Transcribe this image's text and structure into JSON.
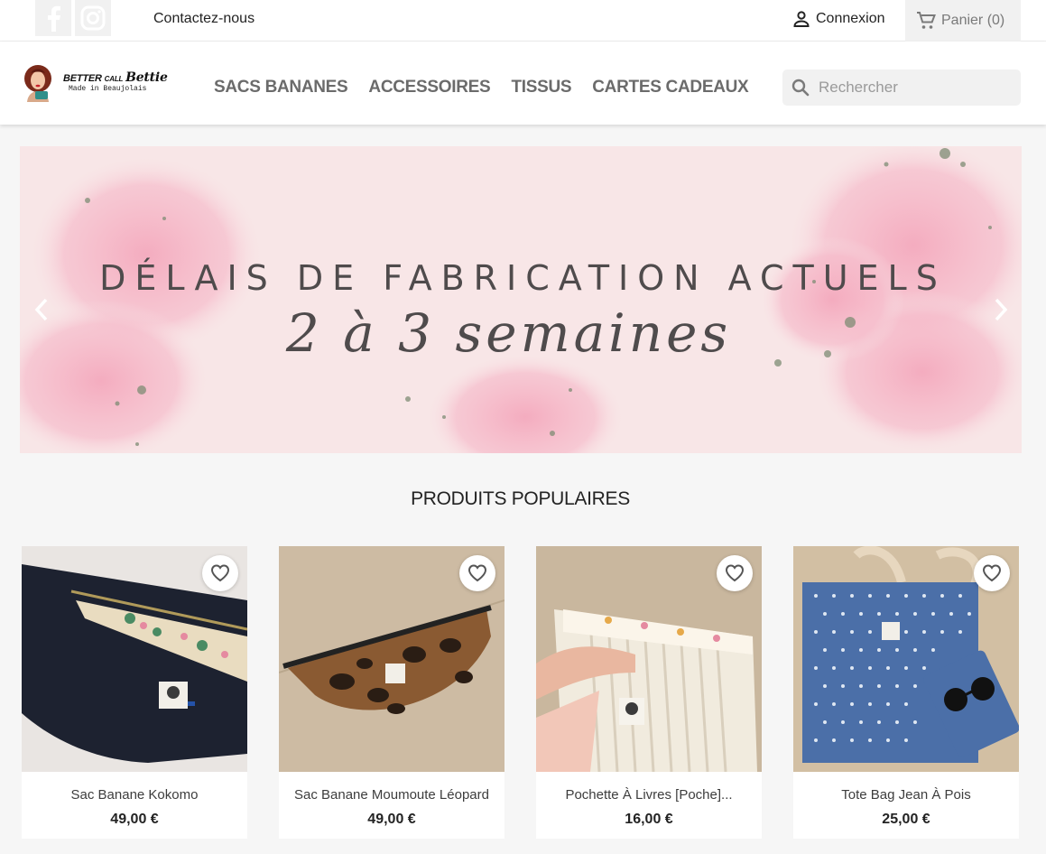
{
  "topbar": {
    "social": [
      "facebook-icon",
      "instagram-icon"
    ],
    "contact": "Contactez-nous",
    "login": "Connexion",
    "cart": "Panier (0)"
  },
  "header": {
    "logo_title_1": "BETTER",
    "logo_title_2": "CALL",
    "logo_title_3": "Bettie",
    "logo_sub": "Made in Beaujolais",
    "nav": [
      "SACS BANANES",
      "ACCESSOIRES",
      "TISSUS",
      "CARTES CADEAUX"
    ],
    "search_placeholder": "Rechercher"
  },
  "banner": {
    "title": "DÉLAIS DE FABRICATION ACTUELS",
    "subtitle": "2 à 3 semaines"
  },
  "section": {
    "title": "PRODUITS POPULAIRES"
  },
  "products": [
    {
      "name": "Sac Banane Kokomo",
      "price": "49,00 €"
    },
    {
      "name": "Sac Banane Moumoute Léopard",
      "price": "49,00 €"
    },
    {
      "name": "Pochette À Livres [Poche]...",
      "price": "16,00 €"
    },
    {
      "name": "Tote Bag Jean À Pois",
      "price": "25,00 €"
    }
  ],
  "colors": {
    "accent_pink": "#f4b6c6",
    "banner_bg": "#f8e6e7",
    "text_dark": "#232323",
    "nav_gray": "#6b6b6b"
  }
}
